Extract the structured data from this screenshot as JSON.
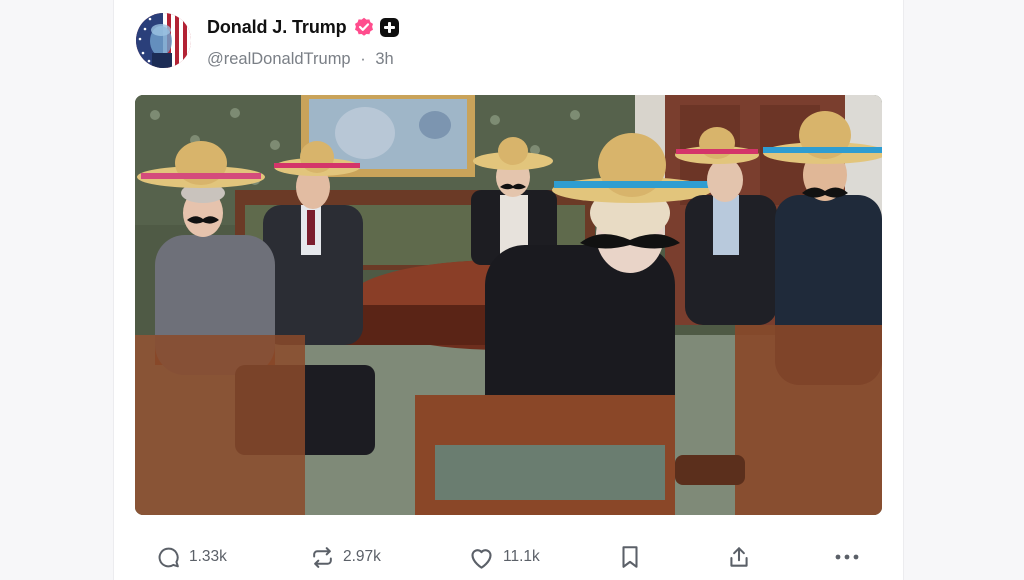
{
  "post": {
    "author_name": "Donald J. Trump",
    "handle": "@realDonaldTrump",
    "separator": "·",
    "time": "3h",
    "avatar": "flag-portrait-avatar",
    "image": "group-photo-sombreros-mustaches"
  },
  "actions": {
    "replies": "1.33k",
    "reposts": "2.97k",
    "likes": "11.1k"
  },
  "icons": {
    "verified": "verified-badge-icon",
    "plus": "plus-square-icon",
    "reply": "reply-icon",
    "repost": "repost-icon",
    "like": "heart-icon",
    "bookmark": "bookmark-icon",
    "share": "share-icon",
    "more": "more-icon"
  },
  "colors": {
    "verified_badge": "#ff4d8d",
    "text_primary": "#111111",
    "text_secondary": "#7a7f86"
  }
}
